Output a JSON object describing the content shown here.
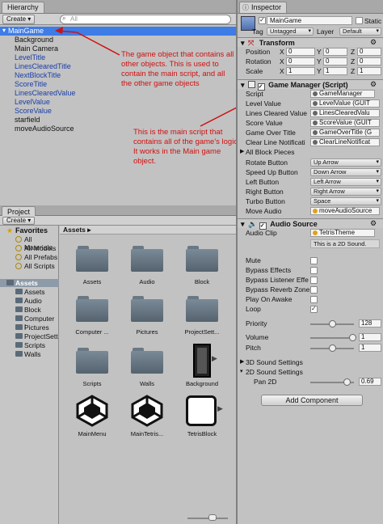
{
  "hierarchy": {
    "tab_label": "Hierarchy",
    "create_label": "Create ▾",
    "search_placeholder": "All",
    "items": [
      {
        "label": "MainGame",
        "selected": true
      },
      {
        "label": "Background"
      },
      {
        "label": "Main Camera"
      },
      {
        "label": "LevelTitle"
      },
      {
        "label": "LinesClearedTitle"
      },
      {
        "label": "NextBlockTitle"
      },
      {
        "label": "ScoreTitle"
      },
      {
        "label": "LinesClearedValue"
      },
      {
        "label": "LevelValue"
      },
      {
        "label": "ScoreValue"
      },
      {
        "label": "starfield"
      },
      {
        "label": "moveAudioSource"
      }
    ]
  },
  "annotations": {
    "first": "The game object that contains all other objects. This is used to contain the main script, and all the other game objects",
    "second": "This is the main script that contains all of the game's logic. It works in the Main game object."
  },
  "project": {
    "tab_label": "Project",
    "create_label": "Create ▾",
    "favorites_label": "Favorites",
    "favorites": [
      "All Materials",
      "All Models",
      "All Prefabs",
      "All Scripts"
    ],
    "assets_label": "Assets",
    "tree": [
      "Assets",
      "Audio",
      "Block",
      "Computer I",
      "Pictures",
      "ProjectSett",
      "Scripts",
      "Walls"
    ],
    "breadcrumb": "Assets ▸",
    "grid": [
      "Assets",
      "Audio",
      "Block",
      "Computer ...",
      "Pictures",
      "ProjectSett...",
      "Scripts",
      "Walls",
      "Background",
      "MainMenu",
      "MainTetris...",
      "TetrisBlock"
    ]
  },
  "inspector": {
    "tab_label": "Inspector",
    "object_name": "MainGame",
    "static_label": "Static",
    "tag_label": "Tag",
    "tag_value": "Untagged",
    "layer_label": "Layer",
    "layer_value": "Default",
    "transform": {
      "title": "Transform",
      "position_label": "Position",
      "rotation_label": "Rotation",
      "scale_label": "Scale",
      "x": "X",
      "y": "Y",
      "z": "Z",
      "position": [
        "0",
        "0",
        "0"
      ],
      "rotation": [
        "0",
        "0",
        "0"
      ],
      "scale": [
        "1",
        "1",
        "1"
      ]
    },
    "game_manager": {
      "title": "Game Manager (Script)",
      "rows": [
        {
          "label": "Script",
          "value": "GameManager"
        },
        {
          "label": "Level Value",
          "value": "LevelValue (GUIT"
        },
        {
          "label": "Lines Cleared Value",
          "value": "LinesClearedValu"
        },
        {
          "label": "Score Value",
          "value": "ScoreValue (GUIT"
        },
        {
          "label": "Game Over Title",
          "value": "GameOverTitle (G"
        },
        {
          "label": "Clear Line Notificati",
          "value": "ClearLineNotificat"
        }
      ],
      "all_block_pieces": "All Block Pieces",
      "buttons": [
        {
          "label": "Rotate Button",
          "value": "Up Arrow"
        },
        {
          "label": "Speed Up Button",
          "value": "Down Arrow"
        },
        {
          "label": "Left Button",
          "value": "Left Arrow"
        },
        {
          "label": "Right Button",
          "value": "Right Arrow"
        },
        {
          "label": "Turbo Button",
          "value": "Space"
        }
      ],
      "move_audio_label": "Move Audio",
      "move_audio_value": "moveAudioSource"
    },
    "audio_source": {
      "title": "Audio Source",
      "clip_label": "Audio Clip",
      "clip_value": "TetrisTheme",
      "clip_note": "This is a 2D Sound.",
      "toggles": [
        {
          "label": "Mute",
          "checked": false
        },
        {
          "label": "Bypass Effects",
          "checked": false
        },
        {
          "label": "Bypass Listener Effe",
          "checked": false
        },
        {
          "label": "Bypass Reverb Zone",
          "checked": false
        },
        {
          "label": "Play On Awake",
          "checked": false
        },
        {
          "label": "Loop",
          "checked": true
        }
      ],
      "priority_label": "Priority",
      "priority_value": "128",
      "priority_level": 0.5,
      "volume_label": "Volume",
      "volume_value": "1",
      "volume_level": 1.0,
      "pitch_label": "Pitch",
      "pitch_value": "1",
      "pitch_level": 0.5,
      "sound3d_label": "3D Sound Settings",
      "sound2d_label": "2D Sound Settings",
      "pan_label": "Pan 2D",
      "pan_value": "0.69",
      "pan_level": 0.85
    },
    "add_component_label": "Add Component"
  },
  "colors": {
    "selection": "#3e7ce6",
    "annotation": "#d01010",
    "link_blue": "#1a3ea8"
  }
}
